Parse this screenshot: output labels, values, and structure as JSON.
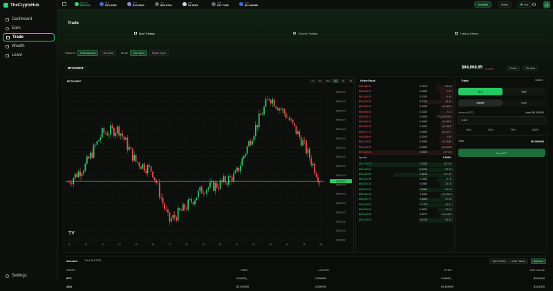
{
  "app": {
    "name": "TheCryptoHub"
  },
  "sidebar": {
    "items": [
      {
        "label": "Dashboard",
        "icon": "grid-icon"
      },
      {
        "label": "Earn",
        "icon": "coin-icon"
      },
      {
        "label": "Trade",
        "icon": "exchange-icon",
        "active": true
      },
      {
        "label": "Wealth",
        "icon": "chart-icon"
      },
      {
        "label": "Learn",
        "icon": "book-icon"
      }
    ],
    "settings_label": "Settings"
  },
  "topbar": {
    "tickers": [
      {
        "symbol": "Portfolio",
        "value": "$276.51",
        "color": "#2fd36b",
        "green": true
      },
      {
        "symbol": "BTC",
        "value": "$70.5353",
        "color": "#3a6ad6"
      },
      {
        "symbol": "ETH",
        "value": "$10.2860",
        "color": "#8a8fd6"
      },
      {
        "symbol": "SOL",
        "value": "$35.5784",
        "color": "#6b6b6b"
      },
      {
        "symbol": "BNB",
        "value": "$1.3683",
        "color": "#d6d6d6"
      },
      {
        "symbol": "XRP",
        "value": "$17.7285",
        "color": "#6b6b6b"
      },
      {
        "symbol": "ADA",
        "value": "$0.246988",
        "color": "#3a6ad6"
      }
    ],
    "buttons": {
      "simplified": "Simplified",
      "wallet": "Wallet",
      "live": "Live"
    },
    "avatar": "LS"
  },
  "page": {
    "title": "Trade",
    "tabs": [
      "Spot Trading",
      "Futures Trading",
      "Trading History"
    ]
  },
  "mode_bar": {
    "platform_label": "Platform",
    "platforms": [
      "Professional",
      "Terminal"
    ],
    "mode_label": "Mode",
    "modes": [
      "Live Spot",
      "Paper Spot"
    ]
  },
  "pair": {
    "symbol": "BTC/USDT",
    "price": "$64,068.85",
    "change": "-0.42%",
    "controls": [
      "Orders",
      "Terminal"
    ]
  },
  "chart": {
    "title": "BTC/USDT",
    "timeframes": [
      "1m",
      "5m",
      "15m",
      "1h",
      "4h",
      "1d"
    ],
    "active_timeframe": "1h",
    "price_ticks": [
      "66000.00",
      "65800.00",
      "65600.00",
      "65400.00",
      "65200.00",
      "65000.00",
      "64800.00",
      "64600.00",
      "64400.00",
      "64200.00",
      "64000.00",
      "63800.00",
      "63600.00",
      "63400.00",
      "63200.00",
      "63000.00",
      "62800.00"
    ],
    "time_ticks": [
      "11",
      "12",
      "13",
      "14",
      "15",
      "16",
      "17",
      "18",
      "19",
      "20",
      "21",
      "22",
      "23",
      "24",
      "25",
      "26"
    ],
    "current_price_tag": "64068.85",
    "watermark": "TV"
  },
  "order_book": {
    "title": "Order Book",
    "asks": [
      {
        "price": "$64,088.50",
        "amount": "0.1376",
        "total": "#3.28"
      },
      {
        "price": "$64,086.30",
        "amount": "0.0280",
        "total": "0.56"
      },
      {
        "price": "$64,084.00",
        "amount": "0.0100",
        "total": "8.48"
      },
      {
        "price": "$64,083.30",
        "amount": "0.6720",
        "total": "43.04"
      },
      {
        "price": "$64,084.23",
        "amount": "0.0050",
        "total": "64.0661"
      },
      {
        "price": "$64,064.00",
        "amount": "0.0320",
        "total": "2.14"
      },
      {
        "price": "$64,063.14",
        "amount": "0.0090",
        "total": "576.3670999"
      },
      {
        "price": "$64,080.90",
        "amount": "0.0060",
        "total": "64.0803"
      },
      {
        "price": "$64,060.40",
        "amount": "0.0030",
        "total": "64.0605"
      },
      {
        "price": "$64,027.70",
        "amount": "0.0050",
        "total": "64.0277"
      },
      {
        "price": "$64,058.60",
        "amount": "0.0240",
        "total": "1.59"
      },
      {
        "price": "$64,054.50",
        "amount": "0.0050",
        "total": "64.0545"
      },
      {
        "price": "$64,054.90",
        "amount": "0.0050",
        "total": "64.0549"
      },
      {
        "price": "$64,052.30",
        "amount": "3.0840",
        "total": "197.5K"
      }
    ],
    "spread_label": "Spread",
    "spread_value": "0.000%",
    "bids": [
      {
        "price": "$64,052.20",
        "amount": "2.9330",
        "total": "187.9K"
      },
      {
        "price": "$64,052.00",
        "amount": "0.9130",
        "total": "58.48"
      },
      {
        "price": "$64,052.80",
        "amount": "1.8640",
        "total": "119.4K"
      },
      {
        "price": "$64,052.50",
        "amount": "0.1060",
        "total": "6.78"
      },
      {
        "price": "$64,051.30",
        "amount": "0.0080",
        "total": "18.78"
      },
      {
        "price": "$64,051.00",
        "amount": "0.8350",
        "total": "53.48"
      },
      {
        "price": "$64,051.40",
        "amount": "0.0050",
        "total": "64.0514"
      },
      {
        "price": "$64,050.70",
        "amount": "0.8080",
        "total": "51.48"
      },
      {
        "price": "$64,050.80",
        "amount": "0.6720",
        "total": "43.04"
      },
      {
        "price": "$64,050.30",
        "amount": "0.0820",
        "total": "43.04"
      },
      {
        "price": "$64,049.50",
        "amount": "0.0070",
        "total": "64.0495"
      },
      {
        "price": "$64,048.00",
        "amount": "0.8740",
        "total": "56.58"
      }
    ]
  },
  "trade_form": {
    "title": "Trade",
    "subtitle": "Orders",
    "buy_label": "Buy",
    "sell_label": "Sell",
    "market_label": "Market",
    "limit_label": "Limit",
    "amount_label": "Amount (BTC)",
    "avail_label": "Avail: $0.000000",
    "amount_value": "0.00",
    "percents": [
      "25%",
      "50%",
      "75%",
      "100%"
    ],
    "total_label": "Total",
    "total_value": "$0.000000",
    "submit_label": "Buy BTC"
  },
  "account": {
    "title": "Account",
    "total_label": "Total: $15.3351",
    "buttons": [
      "Open Orders",
      "Order History",
      "Balances"
    ],
    "columns": [
      "ASSET",
      "FREE",
      "LOCKED",
      "TOTAL",
      "USD VALUE"
    ],
    "rows": [
      [
        "BTC",
        "0.00052₄",
        "0.000000",
        "0.00052₄",
        "$33.6204"
      ],
      [
        "ADA",
        "$1.404539",
        "0.000000",
        "$1.404539",
        "$14.6330"
      ]
    ]
  },
  "chart_data": {
    "type": "candlestick-line",
    "title": "BTC/USDT",
    "x": [
      11,
      12,
      13,
      14,
      15,
      16,
      17,
      18,
      19,
      20,
      21,
      22,
      23,
      24,
      25,
      26
    ],
    "series": [
      {
        "values": [
          64050,
          64400,
          65100,
          65200,
          64500,
          64300,
          63200,
          63500,
          63900,
          64000,
          64200,
          65100,
          65900,
          65500,
          64900,
          64100
        ]
      }
    ],
    "ylim": [
      62800,
      66000
    ],
    "ylabel": "",
    "current_price": 64068.85
  }
}
